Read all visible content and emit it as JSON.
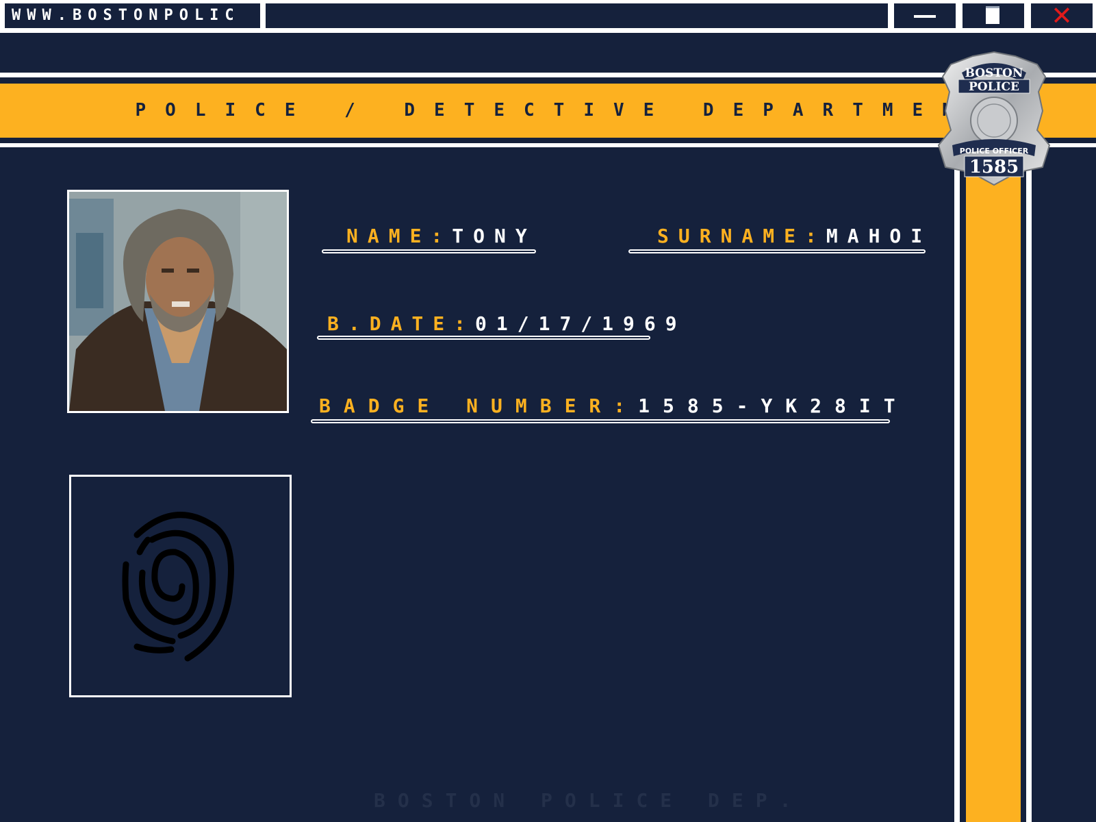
{
  "window": {
    "url_text": "WWW.BOSTONPOLIC",
    "minimize_icon": "minimize-icon",
    "maximize_icon": "maximize-icon",
    "close_icon": "close-icon",
    "close_glyph": "✕"
  },
  "header": {
    "title": "POLICE / DETECTIVE DEPARTMENT"
  },
  "badge": {
    "icon": "police-badge-icon",
    "city": "BOSTON",
    "dept": "POLICE",
    "rank": "POLICE OFFICER",
    "number": "1585"
  },
  "profile": {
    "photo_icon": "suspect-photo",
    "name_label": "NAME:",
    "name_value": "TONY",
    "surname_label": "SURNAME:",
    "surname_value": "MAHOI",
    "bdate_label": "B.DATE:",
    "bdate_value": "01/17/1969",
    "badge_label": "BADGE NUMBER:",
    "badge_value": "1585-YK28IT",
    "fingerprint_icon": "fingerprint-icon"
  },
  "footer": {
    "text": "BOSTON POLICE DEP."
  },
  "colors": {
    "navy": "#15213c",
    "gold": "#fdb120",
    "white": "#ffffff",
    "close_red": "#e01b1b"
  }
}
